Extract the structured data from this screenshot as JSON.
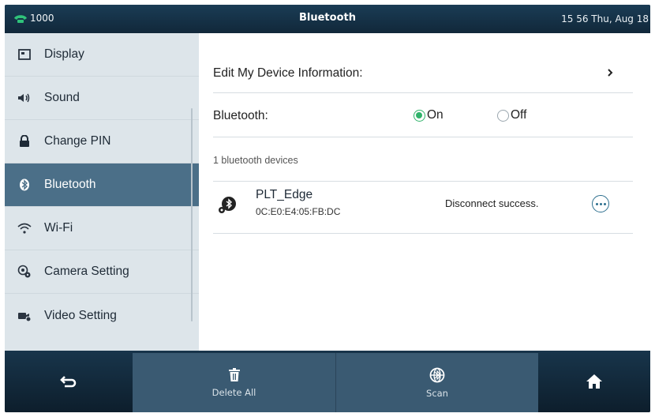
{
  "statusbar": {
    "extension": "1000",
    "title": "Bluetooth",
    "datetime": "15 56 Thu, Aug 18"
  },
  "sidebar": {
    "items": [
      {
        "label": "Display",
        "icon": "display-icon"
      },
      {
        "label": "Sound",
        "icon": "speaker-icon"
      },
      {
        "label": "Change PIN",
        "icon": "lock-icon"
      },
      {
        "label": "Bluetooth",
        "icon": "bluetooth-icon",
        "active": true
      },
      {
        "label": "Wi-Fi",
        "icon": "wifi-icon"
      },
      {
        "label": "Camera Setting",
        "icon": "camera-gear-icon"
      },
      {
        "label": "Video Setting",
        "icon": "video-gear-icon"
      }
    ]
  },
  "content": {
    "edit_label": "Edit My Device Information:",
    "bluetooth_label": "Bluetooth:",
    "on_label": "On",
    "off_label": "Off",
    "bluetooth_state": "On",
    "device_count": "1 bluetooth devices",
    "device": {
      "name": "PLT_Edge",
      "mac": "0C:E0:E4:05:FB:DC",
      "status": "Disconnect success."
    }
  },
  "softkeys": {
    "back_icon": "back-arrow-icon",
    "delete_all": "Delete All",
    "scan": "Scan",
    "home_icon": "home-icon"
  },
  "colors": {
    "accent_green": "#2fb36a",
    "active_item": "#4b6f88",
    "bar_dark": "#11283a"
  }
}
